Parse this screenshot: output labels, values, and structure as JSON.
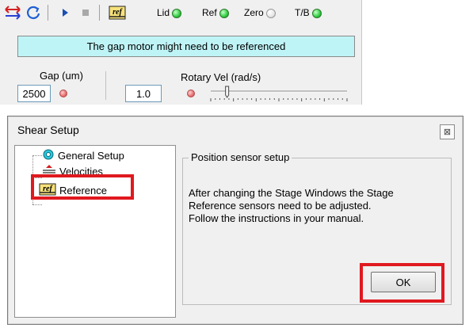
{
  "toolbar": {
    "indicators": [
      {
        "label": "Lid",
        "state": "on"
      },
      {
        "label": "Ref",
        "state": "on"
      },
      {
        "label": "Zero",
        "state": "off"
      },
      {
        "label": "T/B",
        "state": "on"
      }
    ],
    "ref_glyph": "ref",
    "icons": [
      "direction-arrows-icon",
      "refresh-icon",
      "play-icon",
      "stop-icon",
      "reference-icon"
    ]
  },
  "status": {
    "message": "The gap motor might need to be referenced"
  },
  "gap": {
    "label": "Gap (um)",
    "value": "2500"
  },
  "rotary": {
    "label": "Rotary Vel (rad/s)",
    "value": "1.0",
    "slider_fraction": 0.12
  },
  "dialog": {
    "title": "Shear Setup",
    "close_glyph": "⊠",
    "tree": [
      {
        "label": "General Setup",
        "icon": "gear-icon"
      },
      {
        "label": "Velocities",
        "icon": "velocity-icon"
      },
      {
        "label": "Reference",
        "icon": "reference-icon"
      }
    ],
    "group_title": "Position sensor setup",
    "lines": [
      "After changing the Stage Windows the Stage",
      "Reference sensors need to be adjusted.",
      "Follow the instructions in your manual."
    ],
    "ok_label": "OK"
  },
  "colors": {
    "status_bg": "#bff4f7",
    "highlight": "#e0191f",
    "led_on": "#2ecc40"
  }
}
